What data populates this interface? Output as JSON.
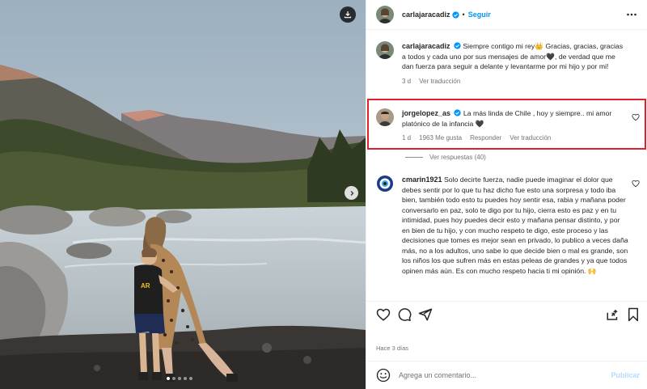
{
  "post": {
    "author": "carlajaracadiz",
    "follow_label": "Seguir",
    "date": "Hace 3 días",
    "carousel_pages": 5,
    "carousel_current": 1
  },
  "caption": {
    "username": "carlajaracadiz",
    "text": "Siempre contigo mi rey👑 Gracias, gracias, gracias a todos y cada uno por sus mensajes de amor🖤, de verdad que me dan fuerza para seguir a delante y levantarme por mi hijo y por mi!",
    "age": "3 d",
    "translate": "Ver traducción"
  },
  "comments": [
    {
      "username": "jorgelopez_as",
      "text": "La más linda de Chile , hoy y siempre.. mi amor platónico de la infancia 🖤",
      "age": "1 d",
      "likes": "1963 Me gusta",
      "reply": "Responder",
      "translate": "Ver traducción",
      "view_replies": "Ver respuestas (40)"
    },
    {
      "username": "cmarin1921",
      "text": "Solo decirte fuerza, nadie puede imaginar el dolor que debes sentir por lo que tu haz dicho fue esto una sorpresa y todo iba bien, también todo esto tu puedes hoy sentir esa, rabia y mañana poder conversarlo en paz, solo te digo por tu hijo, cierra esto es paz y en tu intimidad, pues hoy puedes decir esto y mañana pensar distinto, y por en bien de tu hijo, y con mucho respeto te digo, este proceso y las decisiones que tomes es mejor sean en privado, lo publico a veces daña más, no a los adultos, uno sabe lo que decide bien o mal es grande, son los niños los que sufren más en estas peleas de grandes y ya que todos opinen más aún. Es con mucho respeto hacia ti mi opinión. 🙌"
    }
  ],
  "composer": {
    "placeholder": "Agrega un comentario...",
    "publish_label": "Publicar"
  },
  "colors": {
    "accent": "#0095f6",
    "highlight": "#e0202a",
    "verified": "#0095f6"
  }
}
